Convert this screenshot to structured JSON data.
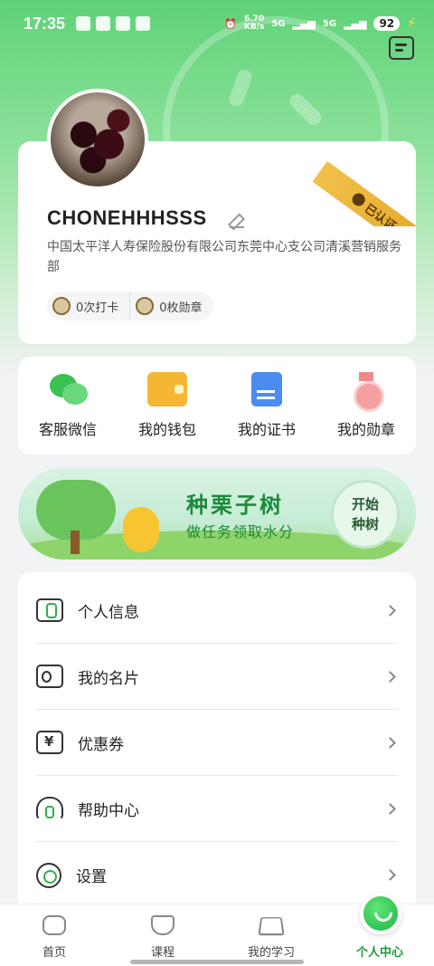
{
  "status_bar": {
    "time": "17:35",
    "net_speed_value": "6.70",
    "net_speed_unit": "KB/s",
    "signal_1": "5G",
    "signal_2": "5G",
    "battery": "92"
  },
  "profile": {
    "username": "CHONEHHHSSS",
    "verified_label": "已认证",
    "company": "中国太平洋人寿保险股份有限公司东莞中心支公司清溪营销服务部",
    "checkins": "0次打卡",
    "medals": "0枚勋章"
  },
  "quick_actions": [
    {
      "label": "客服微信",
      "icon": "wechat-icon"
    },
    {
      "label": "我的钱包",
      "icon": "wallet-icon"
    },
    {
      "label": "我的证书",
      "icon": "certificate-icon"
    },
    {
      "label": "我的勋章",
      "icon": "medal-icon"
    }
  ],
  "banner": {
    "title": "种栗子树",
    "subtitle": "做任务领取水分",
    "button": "开始\n种树"
  },
  "menu": [
    {
      "label": "个人信息",
      "icon": "personal-info-icon"
    },
    {
      "label": "我的名片",
      "icon": "business-card-icon"
    },
    {
      "label": "优惠券",
      "icon": "coupon-icon"
    },
    {
      "label": "帮助中心",
      "icon": "headset-icon"
    },
    {
      "label": "设置",
      "icon": "settings-icon"
    }
  ],
  "tabs": [
    {
      "label": "首页",
      "icon": "home-icon"
    },
    {
      "label": "课程",
      "icon": "course-icon"
    },
    {
      "label": "我的学习",
      "icon": "study-icon"
    },
    {
      "label": "个人中心",
      "icon": "profile-icon",
      "active": true
    }
  ],
  "colors": {
    "brand_green": "#1f9a3c",
    "hero_green": "#5fd278",
    "ribbon_gold": "#f2c14b"
  }
}
